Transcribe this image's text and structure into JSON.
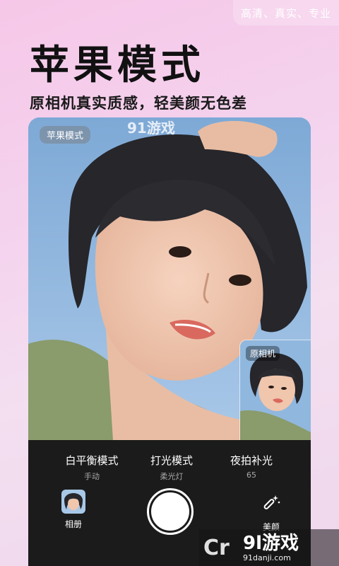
{
  "header": {
    "tagline": "高清、真实、专业",
    "title": "苹果模式",
    "subtitle": "原相机真实质感，轻美颜无色差"
  },
  "preview": {
    "mode_badge": "苹果模式",
    "pip_label": "原相机",
    "brand_overlay": "91游戏",
    "colors": {
      "sky": "#8eb6de",
      "hair": "#2a2a2e",
      "skin": "#f0c6ad"
    }
  },
  "controls": {
    "modes": [
      {
        "name": "白平衡模式",
        "value": "手动"
      },
      {
        "name": "打光模式",
        "value": "柔光灯"
      },
      {
        "name": "夜拍补光",
        "value": "65"
      }
    ],
    "album_label": "相册",
    "beauty_label": "美颜",
    "shutter_icon": "shutter-icon"
  },
  "watermark": {
    "brand": "9l游戏",
    "url": "91danji.com"
  }
}
